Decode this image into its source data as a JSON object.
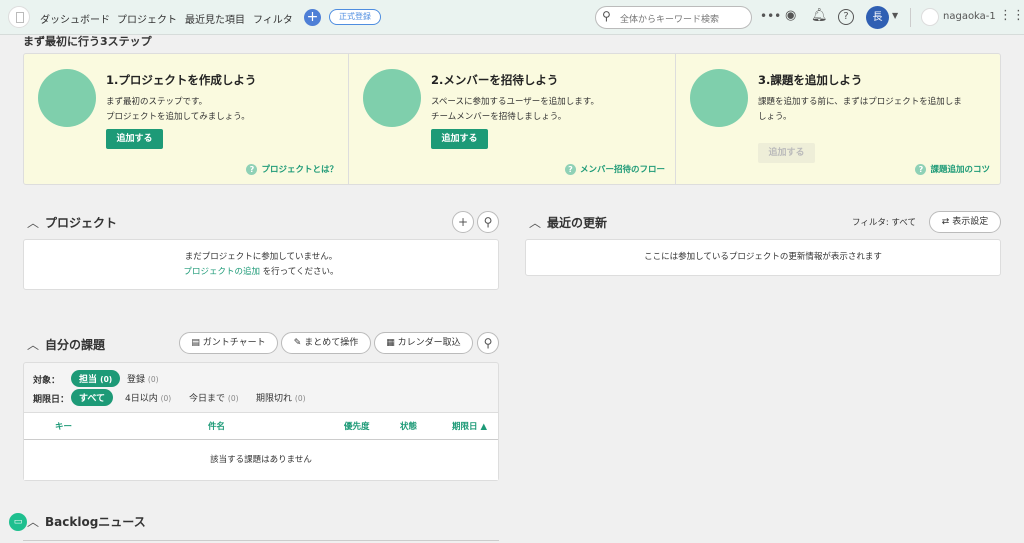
{
  "header": {
    "nav": [
      "ダッシュボード",
      "プロジェクト",
      "最近見た項目",
      "フィルタ"
    ],
    "register": "正式登録",
    "search_placeholder": "全体からキーワード検索",
    "avatar": "長",
    "space": "nagaoka-1"
  },
  "steps": {
    "title": "まず最初に行う3ステップ",
    "items": [
      {
        "title": "1.プロジェクトを作成しよう",
        "desc1": "まず最初のステップです。",
        "desc2": "プロジェクトを追加してみましょう。",
        "button": "追加する",
        "help": "プロジェクトとは？"
      },
      {
        "title": "2.メンバーを招待しよう",
        "desc1": "スペースに参加するユーザーを追加します。",
        "desc2": "チームメンバーを招待しましょう。",
        "button": "追加する",
        "help": "メンバー招待のフロー"
      },
      {
        "title": "3.課題を追加しよう",
        "desc1": "課題を追加する前に、まずはプロジェクトを追加しま",
        "desc2": "しょう。",
        "button": "追加する",
        "help": "課題追加のコツ"
      }
    ]
  },
  "projects": {
    "title": "プロジェクト",
    "empty1": "まだプロジェクトに参加していません。",
    "link": "プロジェクトの追加",
    "empty2": " を行ってください。"
  },
  "updates": {
    "title": "最近の更新",
    "filter": "フィルタ: すべて",
    "settings": "表示設定",
    "empty": "ここには参加しているプロジェクトの更新情報が表示されます"
  },
  "tasks": {
    "title": "自分の課題",
    "gantt": "ガントチャート",
    "bulk": "まとめて操作",
    "calendar": "カレンダー取込",
    "target_label": "対象：",
    "targets": [
      {
        "label": "担当",
        "count": "(0)"
      },
      {
        "label": "登録",
        "count": "(0)"
      }
    ],
    "due_label": "期限日：",
    "dues": [
      {
        "label": "すべて",
        "count": ""
      },
      {
        "label": "4日以内",
        "count": "(0)"
      },
      {
        "label": "今日まで",
        "count": "(0)"
      },
      {
        "label": "期限切れ",
        "count": "(0)"
      }
    ],
    "columns": [
      "キー",
      "件名",
      "優先度",
      "状態",
      "期限日 ▲"
    ],
    "empty": "該当する課題はありません"
  },
  "news": {
    "title": "Backlogニュース"
  }
}
